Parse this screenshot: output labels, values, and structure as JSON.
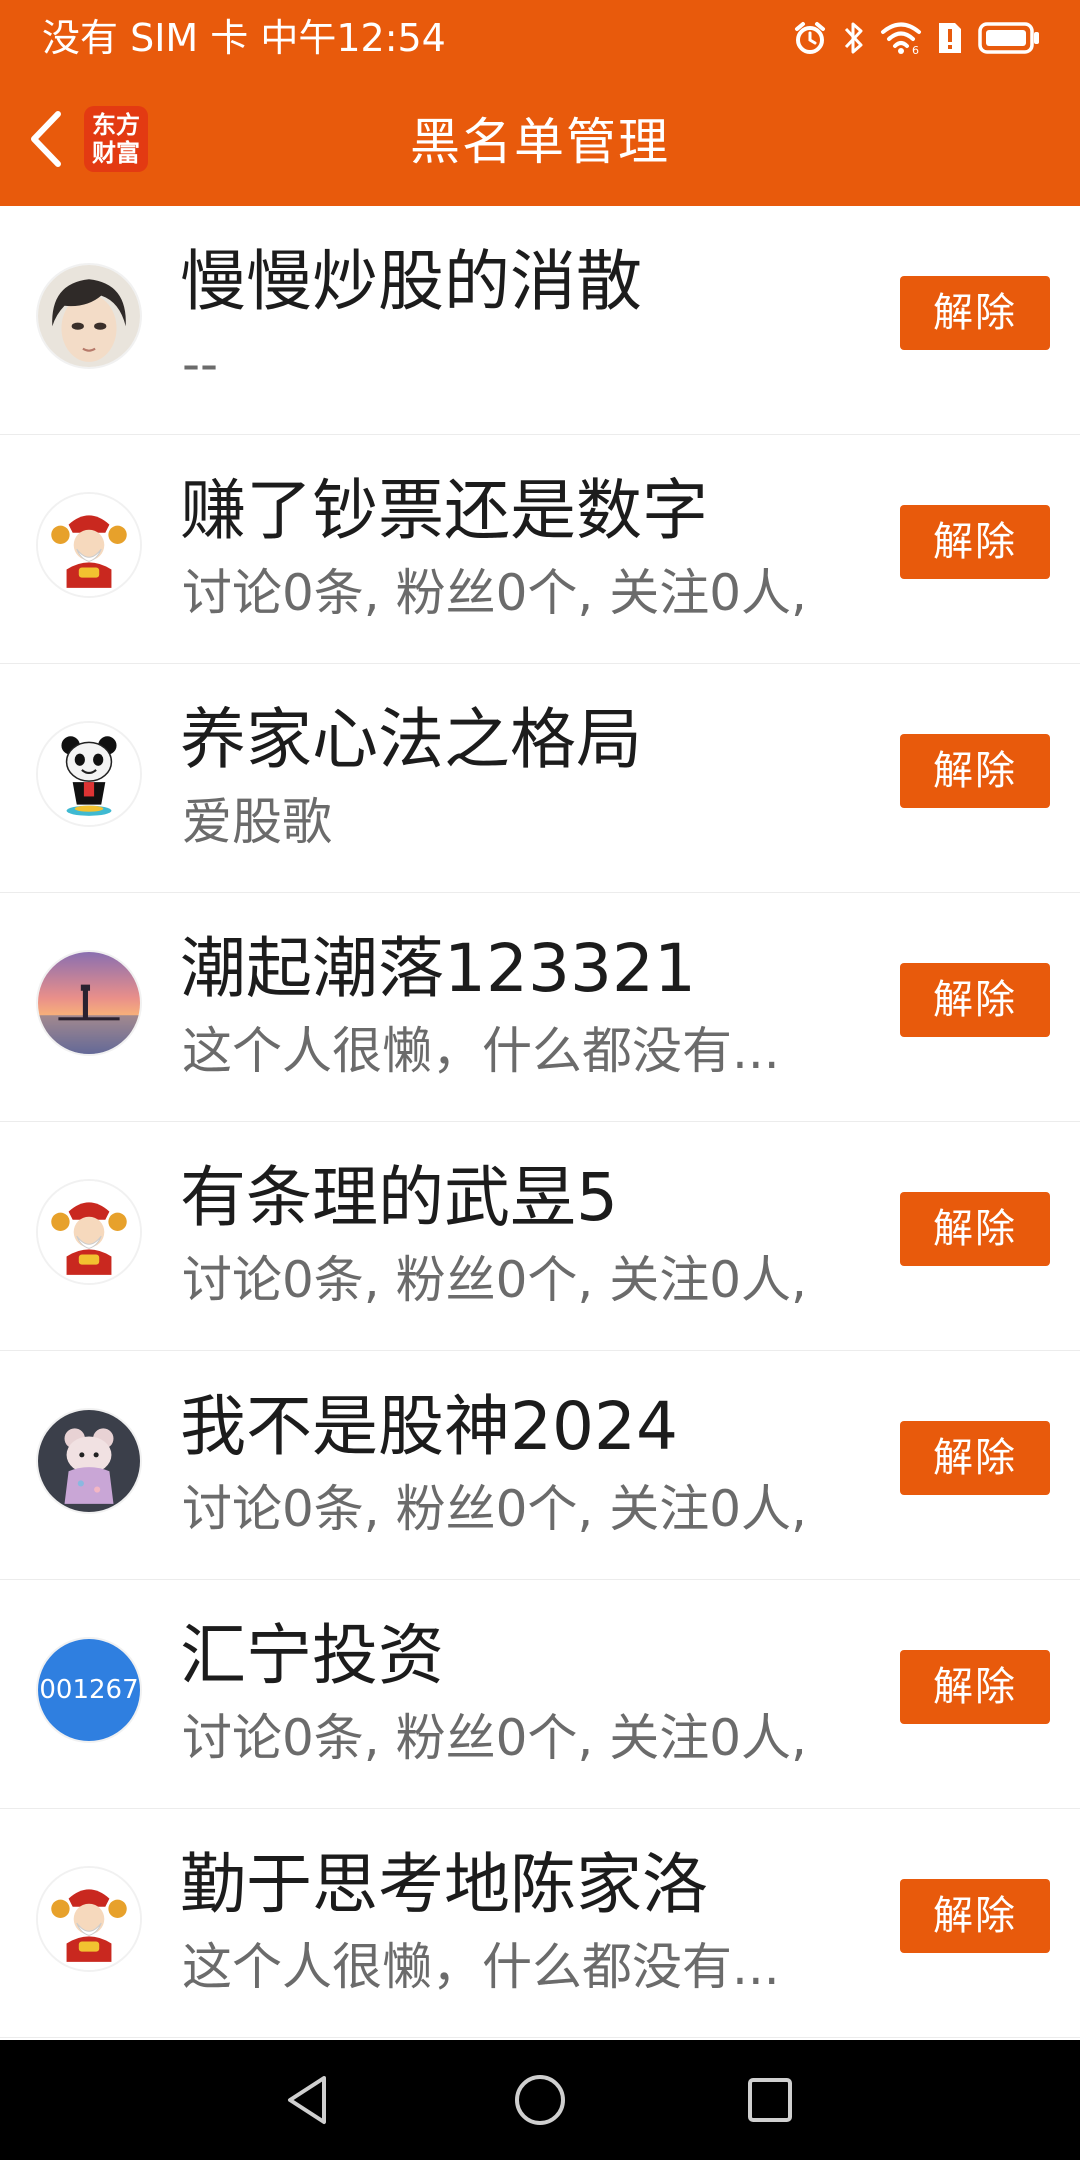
{
  "status_bar": {
    "text": "没有 SIM 卡 中午12:54",
    "icons": [
      "alarm-icon",
      "bluetooth-icon",
      "wifi-icon",
      "sim-alert-icon",
      "battery-icon"
    ]
  },
  "header": {
    "title": "黑名单管理",
    "logo_line1": "东方",
    "logo_line2": "财富",
    "accent_color": "#e85a0c"
  },
  "list": {
    "items": [
      {
        "name": "慢慢炒股的消散",
        "desc": "--",
        "action": "解除",
        "avatar": "anime-portrait"
      },
      {
        "name": "赚了钞票还是数字",
        "desc": "讨论0条, 粉丝0个, 关注0人,",
        "action": "解除",
        "avatar": "fortune-god"
      },
      {
        "name": "养家心法之格局",
        "desc": "爱股歌",
        "action": "解除",
        "avatar": "panda"
      },
      {
        "name": "潮起潮落123321",
        "desc": "这个人很懒，什么都没有...",
        "action": "解除",
        "avatar": "sunset-lighthouse"
      },
      {
        "name": "有条理的武昱5",
        "desc": "讨论0条, 粉丝0个, 关注0人,",
        "action": "解除",
        "avatar": "fortune-god"
      },
      {
        "name": "我不是股神2024",
        "desc": "讨论0条, 粉丝0个, 关注0人,",
        "action": "解除",
        "avatar": "plush-toy"
      },
      {
        "name": "汇宁投资",
        "desc": "讨论0条, 粉丝0个, 关注0人,",
        "action": "解除",
        "avatar": "code-badge",
        "avatar_text": "001267"
      },
      {
        "name": "勤于思考地陈家洛",
        "desc": "这个人很懒，什么都没有...",
        "action": "解除",
        "avatar": "fortune-god"
      }
    ]
  },
  "nav_bar": {
    "buttons": [
      "back-triangle-icon",
      "home-circle-icon",
      "recents-square-icon"
    ]
  }
}
